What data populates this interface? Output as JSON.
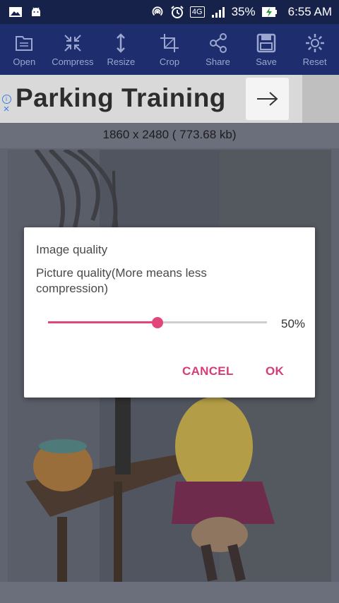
{
  "status_bar": {
    "battery": "35%",
    "time": "6:55 AM",
    "network": "4G",
    "icons": [
      "image-notification-icon",
      "android-icon",
      "hotspot-icon",
      "alarm-icon",
      "signal-icon",
      "battery-charging-icon"
    ]
  },
  "toolbar": {
    "items": [
      {
        "label": "Open",
        "icon": "folder-icon"
      },
      {
        "label": "Compress",
        "icon": "compress-icon"
      },
      {
        "label": "Resize",
        "icon": "resize-icon"
      },
      {
        "label": "Crop",
        "icon": "crop-icon"
      },
      {
        "label": "Share",
        "icon": "share-icon"
      },
      {
        "label": "Save",
        "icon": "save-icon"
      },
      {
        "label": "Reset",
        "icon": "reset-gear-icon"
      }
    ]
  },
  "ad": {
    "headline": "Parking Training",
    "info_glyph": "i",
    "close_glyph": "×"
  },
  "image_info": "1860 x 2480 ( 773.68 kb)",
  "dialog": {
    "title": "Image quality",
    "description": "Picture quality(More means less compression)",
    "value_label": "50%",
    "value": 0.5,
    "cancel_label": "CANCEL",
    "ok_label": "OK"
  },
  "colors": {
    "toolbar_bg": "#1d2d6e",
    "status_bg": "#16224a",
    "accent": "#e2457a",
    "button_text": "#d43d78"
  }
}
